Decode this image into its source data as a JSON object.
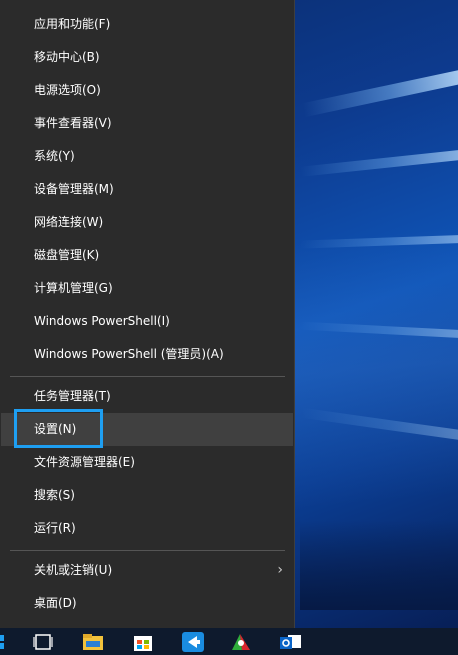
{
  "menu": {
    "items": [
      {
        "label": "应用和功能(F)"
      },
      {
        "label": "移动中心(B)"
      },
      {
        "label": "电源选项(O)"
      },
      {
        "label": "事件查看器(V)"
      },
      {
        "label": "系统(Y)"
      },
      {
        "label": "设备管理器(M)"
      },
      {
        "label": "网络连接(W)"
      },
      {
        "label": "磁盘管理(K)"
      },
      {
        "label": "计算机管理(G)"
      },
      {
        "label": "Windows PowerShell(I)"
      },
      {
        "label": "Windows PowerShell (管理员)(A)"
      },
      {
        "label": "任务管理器(T)"
      },
      {
        "label": "设置(N)"
      },
      {
        "label": "文件资源管理器(E)"
      },
      {
        "label": "搜索(S)"
      },
      {
        "label": "运行(R)"
      },
      {
        "label": "关机或注销(U)"
      },
      {
        "label": "桌面(D)"
      }
    ],
    "highlighted_item": "设置(N)",
    "submenu_chevron": "›"
  },
  "colors": {
    "menu_bg": "#2b2b2b",
    "hover_bg": "#404040",
    "focus_outline": "#1e9ff2",
    "taskbar_bg": "#0e1a2d"
  },
  "taskbar": {
    "icons": [
      "start-icon",
      "task-view-icon",
      "file-explorer-icon",
      "store-icon",
      "mail-arrow-icon",
      "app-icon",
      "outlook-icon"
    ]
  }
}
